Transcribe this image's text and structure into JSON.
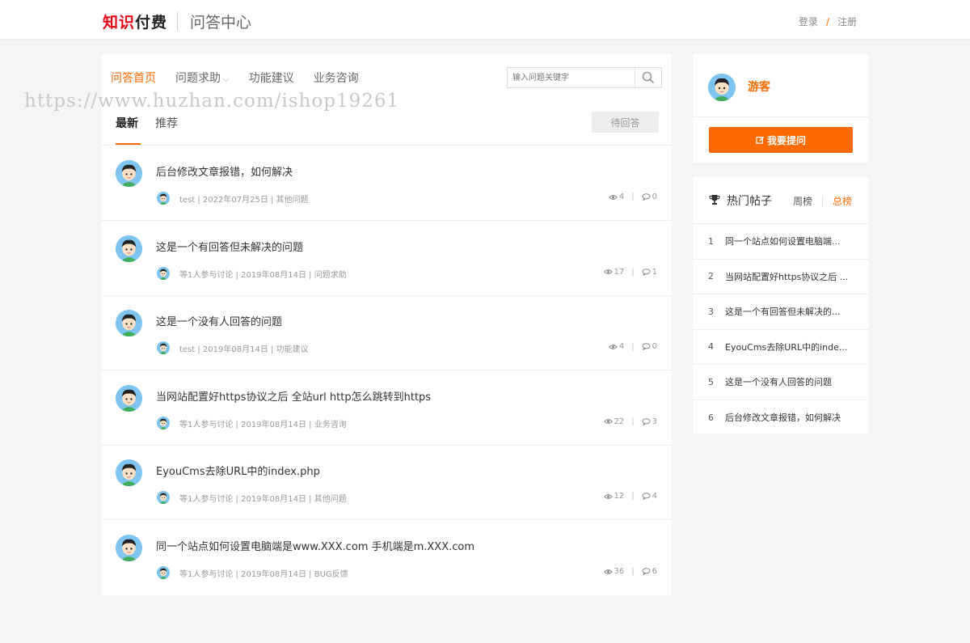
{
  "header": {
    "logo_red": "知识",
    "logo_black": "付费",
    "site_title": "问答中心",
    "login": "登录",
    "slash": "/",
    "register": "注册"
  },
  "watermark": "https://www.huzhan.com/ishop19261",
  "nav": {
    "items": [
      "问答首页",
      "问题求助",
      "功能建议",
      "业务咨询"
    ],
    "dropdown_glyph": "⌵"
  },
  "search": {
    "placeholder": "输入问题关键字"
  },
  "tabs": {
    "latest": "最新",
    "recommend": "推荐"
  },
  "pending_button": "待回答",
  "questions": [
    {
      "title": "后台修改文章报错，如何解决",
      "meta": "test | 2022年07月25日 | 其他问题",
      "views": "4",
      "replies": "0"
    },
    {
      "title": "这是一个有回答但未解决的问题",
      "meta": "等1人参与讨论 | 2019年08月14日 | 问题求助",
      "views": "17",
      "replies": "1"
    },
    {
      "title": "这是一个没有人回答的问题",
      "meta": "test | 2019年08月14日 | 功能建议",
      "views": "4",
      "replies": "0"
    },
    {
      "title": "当网站配置好https协议之后 全站url http怎么跳转到https",
      "meta": "等1人参与讨论 | 2019年08月14日 | 业务咨询",
      "views": "22",
      "replies": "3"
    },
    {
      "title": "EyouCms去除URL中的index.php",
      "meta": "等1人参与讨论 | 2019年08月14日 | 其他问题",
      "views": "12",
      "replies": "4"
    },
    {
      "title": "同一个站点如何设置电脑端是www.XXX.com 手机端是m.XXX.com",
      "meta": "等1人参与讨论 | 2019年08月14日 | BUG反馈",
      "views": "36",
      "replies": "6"
    }
  ],
  "stats_sep": "|",
  "user": {
    "name": "游客",
    "ask_button": "我要提问"
  },
  "hot": {
    "title": "热门帖子",
    "week": "周榜",
    "total": "总榜",
    "items": [
      {
        "num": "1",
        "text": "同一个站点如何设置电脑端..."
      },
      {
        "num": "2",
        "text": "当网站配置好https协议之后 ..."
      },
      {
        "num": "3",
        "text": "这是一个有回答但未解决的..."
      },
      {
        "num": "4",
        "text": "EyouCms去除URL中的inde..."
      },
      {
        "num": "5",
        "text": "这是一个没有人回答的问题"
      },
      {
        "num": "6",
        "text": "后台修改文章报错，如何解决"
      }
    ]
  },
  "colors": {
    "accent": "#ff6a00",
    "logo_red": "#e60012"
  }
}
